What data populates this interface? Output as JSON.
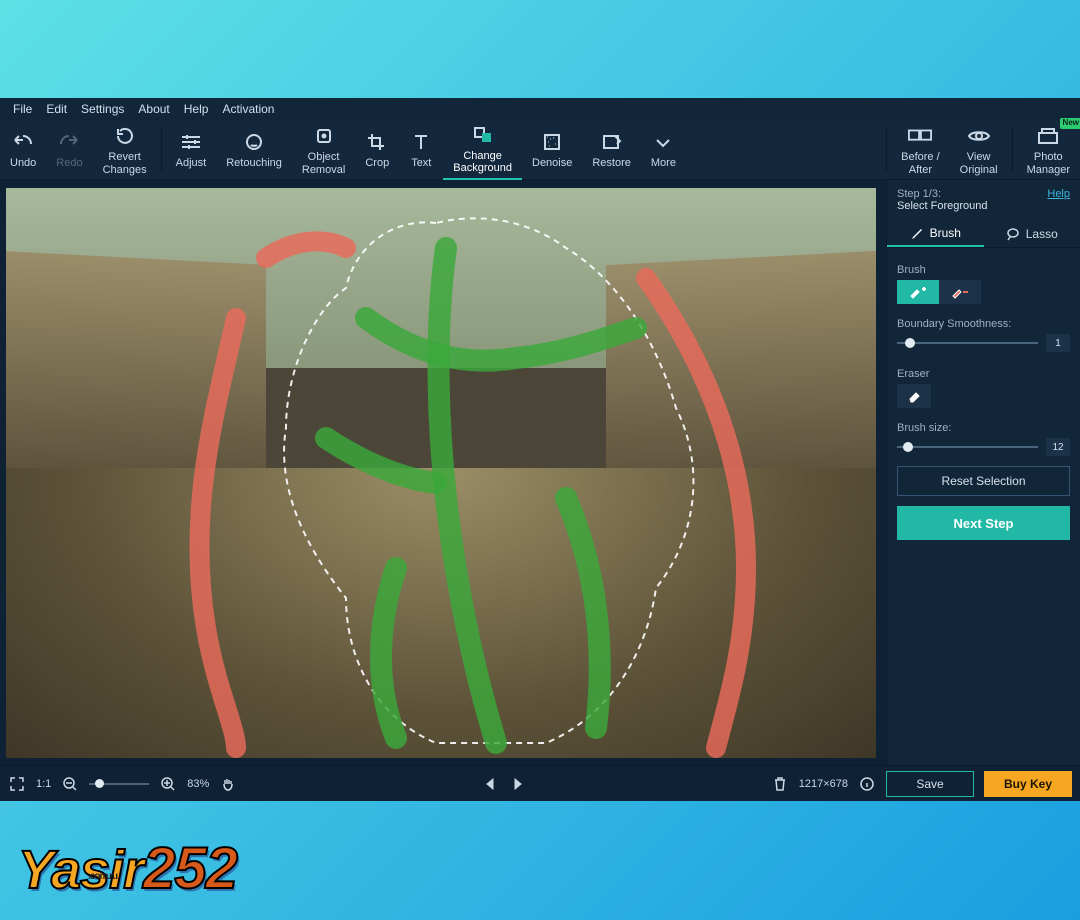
{
  "menu": {
    "items": [
      "File",
      "Edit",
      "Settings",
      "About",
      "Help",
      "Activation"
    ]
  },
  "toolbar": {
    "undo": "Undo",
    "redo": "Redo",
    "revert": "Revert\nChanges",
    "adjust": "Adjust",
    "retouch": "Retouching",
    "object": "Object\nRemoval",
    "crop": "Crop",
    "text": "Text",
    "changeBg": "Change\nBackground",
    "denoise": "Denoise",
    "restore": "Restore",
    "more": "More",
    "beforeAfter": "Before /\nAfter",
    "viewOrig": "View\nOriginal",
    "photoMgr": "Photo\nManager",
    "newBadge": "New"
  },
  "panel": {
    "step": "Step 1/3:",
    "stepTitle": "Select Foreground",
    "help": "Help",
    "tabBrush": "Brush",
    "tabLasso": "Lasso",
    "brushLabel": "Brush",
    "boundaryLabel": "Boundary Smoothness:",
    "boundaryValue": "1",
    "eraserLabel": "Eraser",
    "sizeLabel": "Brush size:",
    "sizeValue": "12",
    "reset": "Reset Selection",
    "next": "Next Step"
  },
  "status": {
    "oneToOne": "1:1",
    "zoom": "83%",
    "dims": "1217×678",
    "save": "Save",
    "buy": "Buy Key"
  },
  "watermark": {
    "a": "Yasir",
    "b": "252",
    "sub": ".com.ru"
  }
}
